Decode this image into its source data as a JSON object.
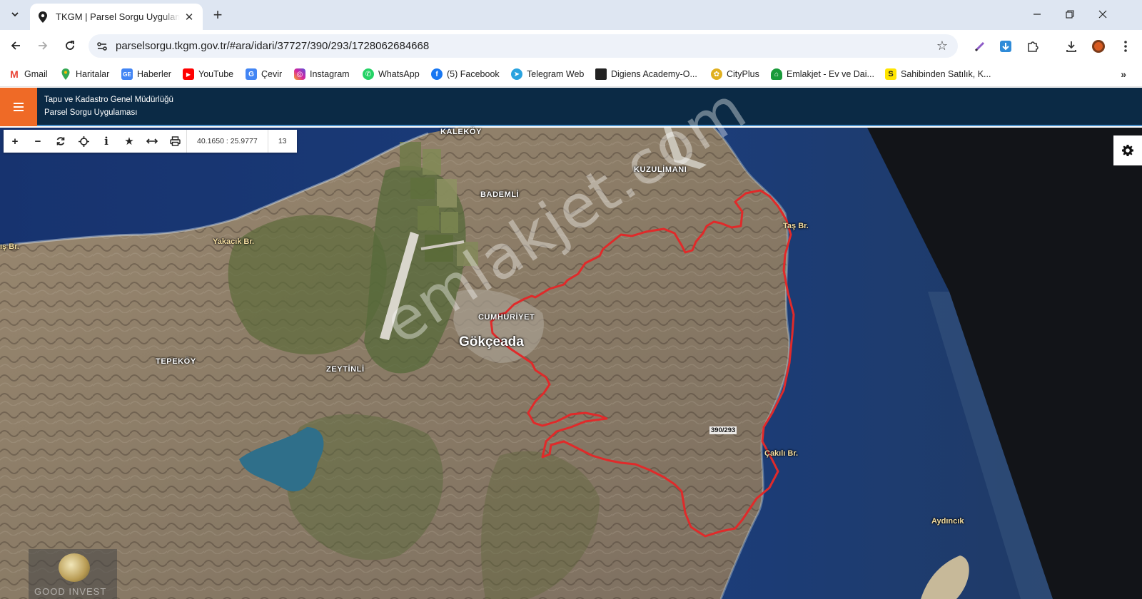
{
  "browser": {
    "tab_title": "TKGM | Parsel Sorgu Uygulaması",
    "url": "parselsorgu.tkgm.gov.tr/#ara/idari/37727/390/293/1728062684668",
    "bookmarks": [
      {
        "label": "Gmail",
        "icon": "gmail-icon",
        "color": "#ea4335"
      },
      {
        "label": "Haritalar",
        "icon": "maps-icon",
        "color": "#34a853"
      },
      {
        "label": "Haberler",
        "icon": "news-icon",
        "color": "#4285f4"
      },
      {
        "label": "YouTube",
        "icon": "youtube-icon",
        "color": "#ff0000"
      },
      {
        "label": "Çevir",
        "icon": "translate-icon",
        "color": "#4285f4"
      },
      {
        "label": "Instagram",
        "icon": "instagram-icon",
        "color": "#d6249f"
      },
      {
        "label": "WhatsApp",
        "icon": "whatsapp-icon",
        "color": "#25d366"
      },
      {
        "label": "(5) Facebook",
        "icon": "facebook-icon",
        "color": "#1877f2"
      },
      {
        "label": "Telegram Web",
        "icon": "telegram-icon",
        "color": "#2aa3df"
      },
      {
        "label": "Digiens Academy-O...",
        "icon": "digiens-icon",
        "color": "#222222"
      },
      {
        "label": "CityPlus",
        "icon": "cityplus-icon",
        "color": "#e0b020"
      },
      {
        "label": "Emlakjet - Ev ve Dai...",
        "icon": "emlakjet-icon",
        "color": "#1a9a3a"
      },
      {
        "label": "Sahibinden Satılık, K...",
        "icon": "sahibinden-icon",
        "color": "#ffe500"
      }
    ]
  },
  "app": {
    "org": "Tapu ve Kadastro Genel Müdürlüğü",
    "name": "Parsel Sorgu Uygulaması"
  },
  "map": {
    "coordinates": "40.1650 : 25.9777",
    "zoom": "13",
    "place_labels": {
      "kalekoy": "KALEKÖY",
      "kuzulimani": "KUZULİMANI",
      "bademli": "BADEMLİ",
      "tas_br": "Taş Br.",
      "yakacik_br": "Yakacık Br.",
      "si_br": "ış Br.",
      "cumhuriyet": "CUMHURİYET",
      "gokceada": "Gökçeada",
      "tepekoy": "TEPEKÖY",
      "zeytinli": "ZEYTİNLİ",
      "cakili_br": "Çakılı Br.",
      "aydincik": "Aydıncık"
    },
    "parcel_label": "390/293",
    "watermark": "emlakjet.com",
    "logo_text": "GOOD INVEST"
  },
  "colors": {
    "app_header": "#0b2a45",
    "menu_button": "#ef6a26",
    "parcel_outline": "#e02a2a",
    "sea": "#1a3570"
  }
}
